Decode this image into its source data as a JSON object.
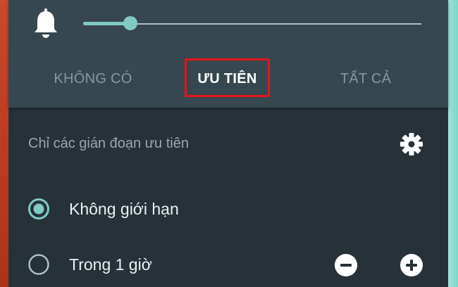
{
  "tabs": [
    {
      "label": "KHÔNG CÓ",
      "active": false
    },
    {
      "label": "ƯU TIÊN",
      "active": true
    },
    {
      "label": "TẤT CẢ",
      "active": false
    }
  ],
  "volume": {
    "level": 0.14
  },
  "section": {
    "title": "Chỉ các gián đoạn ưu tiên"
  },
  "options": [
    {
      "label": "Không giới hạn",
      "selected": true
    },
    {
      "label": "Trong 1 giờ",
      "selected": false
    }
  ],
  "colors": {
    "accent": "#80cbc4",
    "highlight": "#e3141d",
    "panel_top": "#37474f",
    "panel_body": "#263238"
  },
  "icons": {
    "bell": "bell-icon",
    "gear": "gear-icon",
    "minus": "minus-circle-icon",
    "plus": "plus-circle-icon"
  }
}
